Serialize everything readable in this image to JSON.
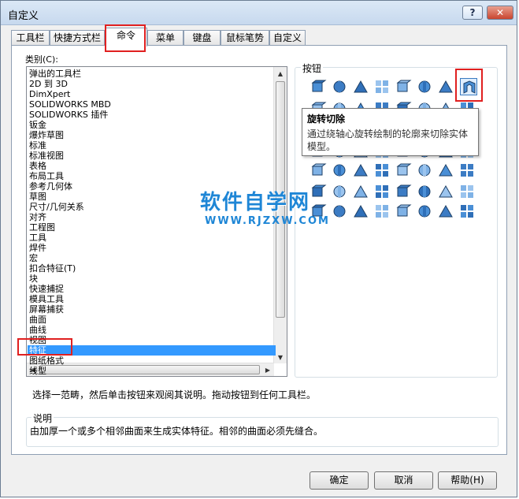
{
  "window": {
    "title": "自定义",
    "help_label": "?",
    "close_label": "✕"
  },
  "tabs": [
    "工具栏",
    "快捷方式栏",
    "命令",
    "菜单",
    "键盘",
    "鼠标笔势",
    "自定义"
  ],
  "category": {
    "label": "类别(C):",
    "items": [
      "弹出的工具栏",
      "2D 到 3D",
      "DimXpert",
      "SOLIDWORKS MBD",
      "SOLIDWORKS 插件",
      "钣金",
      "爆炸草图",
      "标准",
      "标准视图",
      "表格",
      "布局工具",
      "参考几何体",
      "草图",
      "尺寸/几何关系",
      "对齐",
      "工程图",
      "工具",
      "焊件",
      "宏",
      "扣合特征(T)",
      "块",
      "快速捕捉",
      "模具工具",
      "屏幕捕获",
      "曲面",
      "曲线",
      "视图",
      "特征",
      "图纸格式",
      "线型"
    ],
    "selected_index": 27
  },
  "buttons_group": {
    "label": "按钮",
    "icons": [
      "extrude-boss-icon",
      "revolve-boss-icon",
      "sweep-boss-icon",
      "draft-arrow-icon",
      "extrude-cut-icon",
      "move-face-icon",
      "shell-icon",
      "revolved-cut-icon",
      "rib-icon",
      "wrap-icon",
      "hole-wizard-icon",
      "fillet-icon",
      "chamfer-icon",
      "draft-icon",
      "linear-pattern-icon",
      "combine-icon",
      "intersect-icon",
      "split-icon",
      "delete-body-icon",
      "thicken-icon",
      "mirror-icon",
      "scale-icon",
      "move-body-icon",
      "indent-icon",
      "flex-icon",
      "deform-icon",
      "dome-icon",
      "freeform-icon",
      "shape-icon",
      "stitch-icon",
      "knit-icon",
      "cavity-icon",
      "mold-icon",
      "fill-pattern-icon",
      "table-pattern-icon",
      "sketch-pattern-icon",
      "curve-pattern-icon",
      "body-icon",
      "check-icon",
      "grid-icon",
      "mesh-icon",
      "convert-icon",
      "extend-icon",
      "trim-icon",
      "lock-icon",
      "split-line-icon",
      "face-icon",
      "feature-grid-icon"
    ]
  },
  "tooltip": {
    "title": "旋转切除",
    "body": "通过绕轴心旋转绘制的轮廓来切除实体模型。"
  },
  "instruction": "选择一范畴，然后单击按钮来观阅其说明。拖动按钮到任何工具栏。",
  "description": {
    "label": "说明",
    "text": "由加厚一个或多个相邻曲面来生成实体特征。相邻的曲面必须先缝合。"
  },
  "dialog_buttons": {
    "ok": "确定",
    "cancel": "取消",
    "help": "帮助(H)"
  },
  "watermark": {
    "main": "软件自学网",
    "sub": "WWW.RJZXW.COM"
  },
  "colors": {
    "selection": "#3399ff",
    "highlight_box": "#e02020",
    "watermark": "#1e86d6"
  }
}
